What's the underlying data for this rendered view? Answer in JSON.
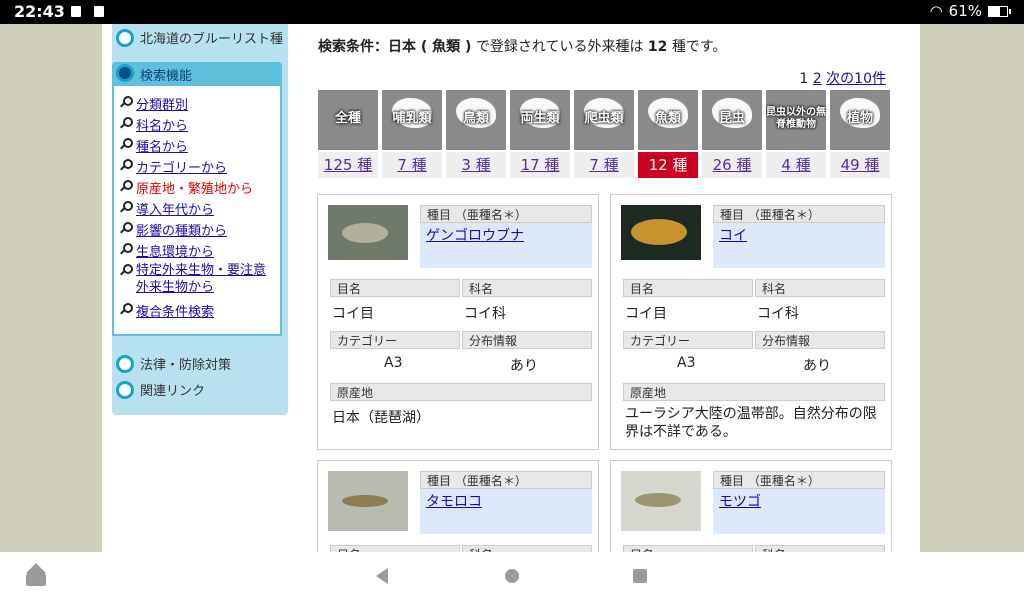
{
  "status": {
    "time": "22:43",
    "battery": "61%"
  },
  "sidebar": {
    "blue_list": "北海道のブルーリスト種",
    "search_title": "検索機能",
    "menu": [
      "分類群別",
      "科名から",
      "種名から",
      "カテゴリーから",
      "原産地・繁殖地から",
      "導入年代から",
      "影響の種類から",
      "生息環境から",
      "特定外来生物・要注意",
      "外来生物から",
      "複合条件検索"
    ],
    "law": "法律・防除対策",
    "links": "関連リンク"
  },
  "main": {
    "cond_label": "検索条件：日本 ( 魚類 )",
    "cond_mid": " で登録されている外来種は ",
    "cond_count": "12",
    "cond_end": " 種です。",
    "pager": {
      "current": "1",
      "page2": "2",
      "next": "次の10件"
    },
    "categories": [
      {
        "name": "全種",
        "count": "125 種"
      },
      {
        "name": "哺乳類",
        "count": "7 種"
      },
      {
        "name": "鳥類",
        "count": "3 種"
      },
      {
        "name": "両生類",
        "count": "17 種"
      },
      {
        "name": "爬虫類",
        "count": "7 種"
      },
      {
        "name": "魚類",
        "count": "12 種"
      },
      {
        "name": "昆虫",
        "count": "26 種"
      },
      {
        "name": "昆虫以外の無脊椎動物",
        "count": "4 種"
      },
      {
        "name": "植物",
        "count": "49 種"
      }
    ],
    "labels": {
      "species": "種目 （亜種名＊）",
      "order": "目名",
      "family": "科名",
      "category": "カテゴリー",
      "distribution": "分布情報",
      "origin": "原産地"
    },
    "cards": [
      {
        "name": "ゲンゴロウブナ",
        "order": "コイ目",
        "family": "コイ科",
        "category": "A3",
        "distribution": "あり",
        "origin": "日本（琵琶湖）"
      },
      {
        "name": "コイ",
        "order": "コイ目",
        "family": "コイ科",
        "category": "A3",
        "distribution": "あり",
        "origin": "ユーラシア大陸の温帯部。自然分布の限界は不詳である。"
      },
      {
        "name": "タモロコ"
      },
      {
        "name": "モツゴ"
      }
    ]
  },
  "colors": {
    "accent": "#5ec0dc",
    "active_count": "#cc0022",
    "sidebar_bg": "#b7e1ee"
  }
}
